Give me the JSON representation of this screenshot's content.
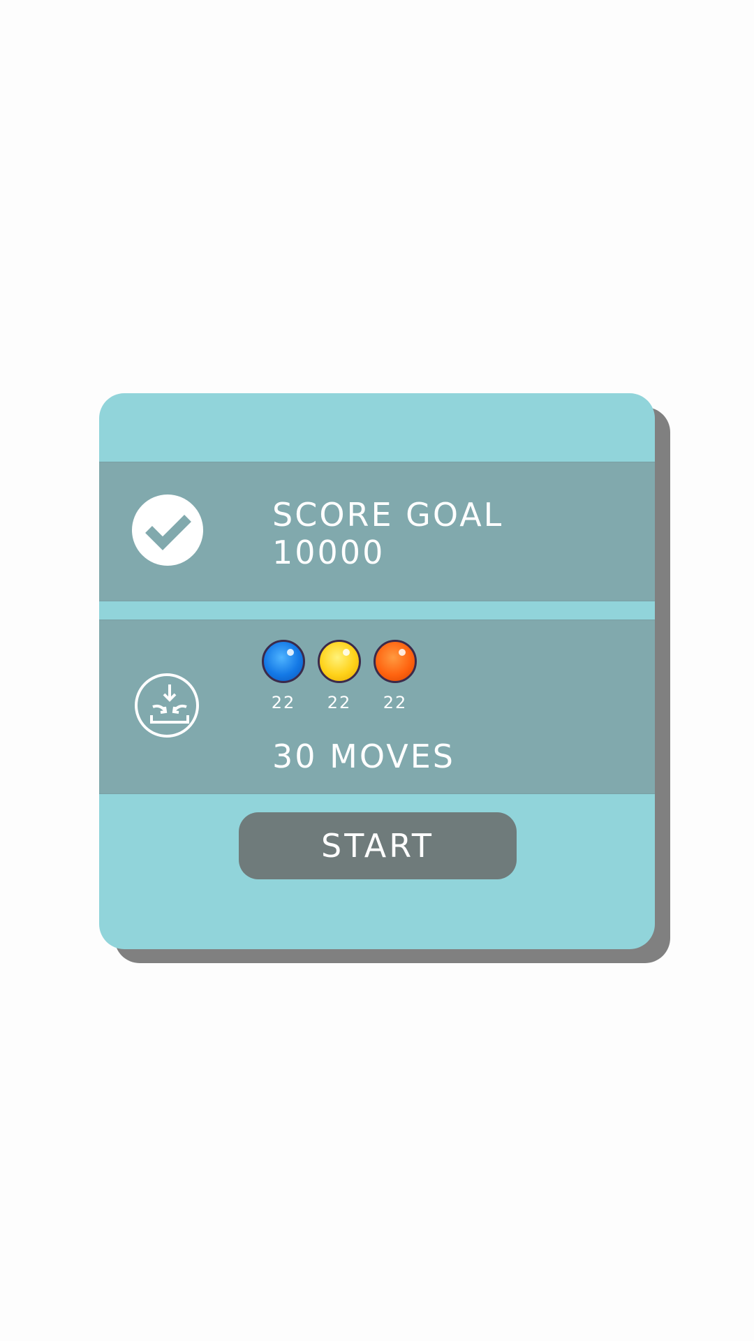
{
  "level_card": {
    "score_goal": {
      "title": "SCORE GOAL",
      "value": "10000",
      "icon": "checkmark-circle-icon"
    },
    "collect": {
      "icon": "collect-tray-icon",
      "items": [
        {
          "color_name": "blue",
          "color": "#1479e6",
          "count": "22"
        },
        {
          "color_name": "yellow",
          "color": "#ffd21a",
          "count": "22"
        },
        {
          "color_name": "orange",
          "color": "#ff6410",
          "count": "22"
        }
      ],
      "moves_label": "30 MOVES"
    },
    "start_label": "START"
  },
  "colors": {
    "card_background": "#91d4da",
    "band_background": "#81a9ad",
    "button_background": "#6f7b7b",
    "shadow": "#808080",
    "page_background": "#fdfdfd"
  }
}
